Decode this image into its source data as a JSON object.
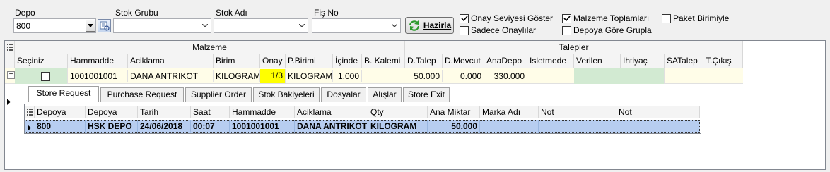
{
  "filters": {
    "depo": {
      "label": "Depo",
      "value": "800"
    },
    "stok_grubu": {
      "label": "Stok Grubu",
      "value": ""
    },
    "stok_adi": {
      "label": "Stok Adı",
      "value": ""
    },
    "fis_no": {
      "label": "Fiş No",
      "value": ""
    },
    "prepare_button": "Hazirla"
  },
  "options": [
    {
      "label": "Onay Seviyesi Göster",
      "checked": true
    },
    {
      "label": "Malzeme Toplamları",
      "checked": true
    },
    {
      "label": "Paket Birimiyle",
      "checked": false
    },
    {
      "label": "Sadece Onaylılar",
      "checked": false
    },
    {
      "label": "Depoya Göre Grupla",
      "checked": false
    }
  ],
  "main_grid": {
    "band_malzeme": "Malzeme",
    "band_talepler": "Talepler",
    "columns": [
      "Seçiniz",
      "Hammadde",
      "Aciklama",
      "Birim",
      "Onay",
      "P.Birimi",
      "İçinde",
      "B. Kalemi",
      "D.Talep",
      "D.Mevcut",
      "AnaDepo",
      "Isletmede",
      "Verilen",
      "Ihtiyaç",
      "SATalep",
      "T.Çıkış"
    ],
    "row": {
      "hammadde": "1001001001",
      "aciklama": "DANA ANTRIKOT",
      "birim": "KILOGRAM",
      "onay": "1/3",
      "p_birimi": "KILOGRAM",
      "icinde": "1.000",
      "b_kalemi": "",
      "d_talep": "50.000",
      "d_mevcut": "0.000",
      "ana_depo": "330.000"
    }
  },
  "tabs": [
    "Store Request",
    "Purchase Request",
    "Supplier Order",
    "Stok Bakiyeleri",
    "Dosyalar",
    "Alışlar",
    "Store Exit"
  ],
  "detail_grid": {
    "columns": [
      "Depoya",
      "Depoya",
      "Tarih",
      "Saat",
      "Hammadde",
      "Aciklama",
      "Qty",
      "Ana Miktar",
      "Marka Adı",
      "Not",
      "Not"
    ],
    "row": {
      "depo_no": "800",
      "depo_adi": "HSK DEPO",
      "tarih": "24/06/2018",
      "saat": "00:07",
      "hammadde": "1001001001",
      "aciklama": "DANA ANTRIKOT",
      "qty": "KILOGRAM",
      "ana_miktar": "50.000"
    }
  },
  "colors": {
    "selected_row": "#b7cdf0",
    "onay_highlight": "#ffff00",
    "green_cell": "#d2ead2",
    "yellow_row": "#fffde8"
  }
}
